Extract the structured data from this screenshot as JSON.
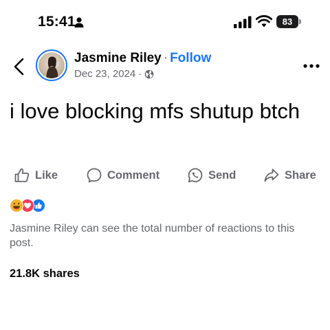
{
  "status_bar": {
    "time": "15:41",
    "battery": "83",
    "icons": [
      "person-icon",
      "signal-icon",
      "wifi-icon",
      "battery-icon"
    ]
  },
  "post": {
    "author": "Jasmine Riley",
    "separator": "·",
    "follow_label": "Follow",
    "date": "Dec 23, 2024",
    "meta_separator": "·",
    "privacy_icon": "globe-icon",
    "text": "i love blocking mfs shutup btch"
  },
  "actions": {
    "like": "Like",
    "comment": "Comment",
    "send": "Send",
    "share": "Share"
  },
  "reactions": {
    "types": [
      "haha",
      "love",
      "like"
    ],
    "note": "Jasmine Riley can see the total number of reactions to this post."
  },
  "shares": "21.8K shares",
  "colors": {
    "accent": "#1877f2",
    "secondary_text": "#65676b",
    "love": "#f33e58",
    "haha": "#f7b125"
  }
}
